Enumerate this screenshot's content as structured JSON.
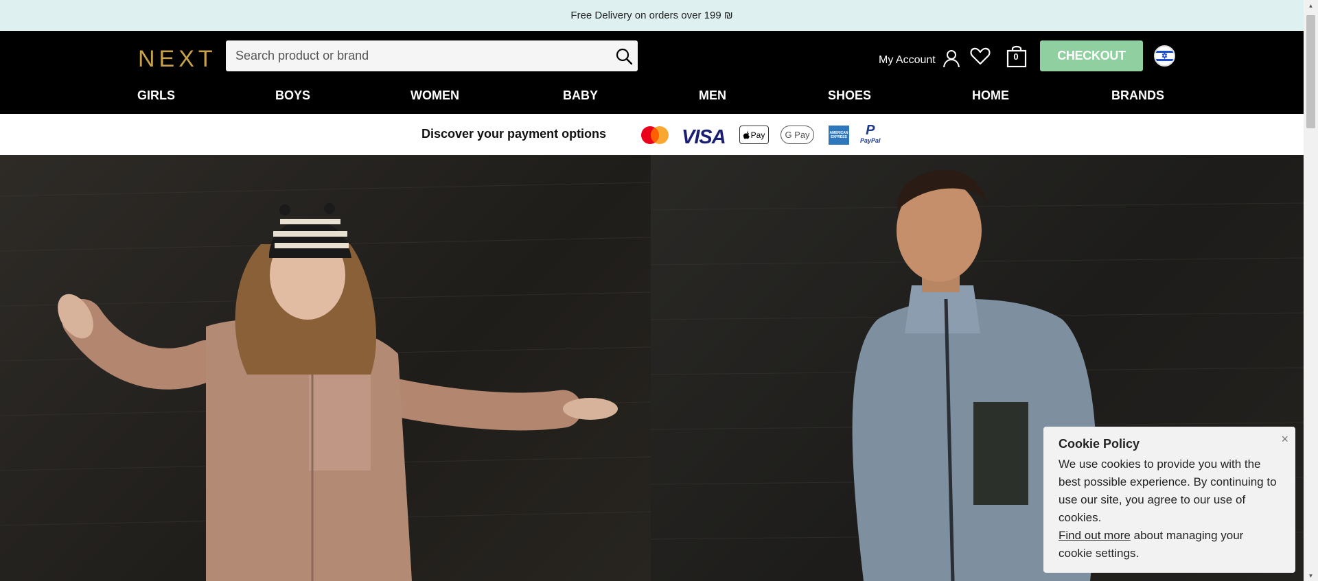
{
  "promo": {
    "text": "Free Delivery on orders over 199 ₪"
  },
  "header": {
    "logo": "NEXT",
    "search_placeholder": "Search product or brand",
    "account_label": "My Account",
    "bag_count": "0",
    "checkout_label": "CHECKOUT"
  },
  "nav": {
    "items": [
      "GIRLS",
      "BOYS",
      "WOMEN",
      "BABY",
      "MEN",
      "SHOES",
      "HOME",
      "BRANDS"
    ]
  },
  "payments": {
    "label": "Discover your payment options",
    "methods": [
      "mastercard",
      "visa",
      "apple-pay",
      "google-pay",
      "american-express",
      "paypal"
    ],
    "visa_text": "VISA",
    "applepay_text": "Pay",
    "googlepay_text": "G Pay",
    "amex_text": "AMERICAN EXPRESS",
    "paypal_text": "PayPal"
  },
  "cookie": {
    "title": "Cookie Policy",
    "body": "We use cookies to provide you with the best possible experience. By continuing to use our site, you agree to our use of cookies.",
    "link_text": "Find out more",
    "link_suffix": " about managing your cookie settings.",
    "close": "×"
  },
  "colors": {
    "promo_bg": "#def0ef",
    "logo_gold": "#c7a24b",
    "checkout_green": "#90cfa0",
    "header_bg": "#000000"
  }
}
